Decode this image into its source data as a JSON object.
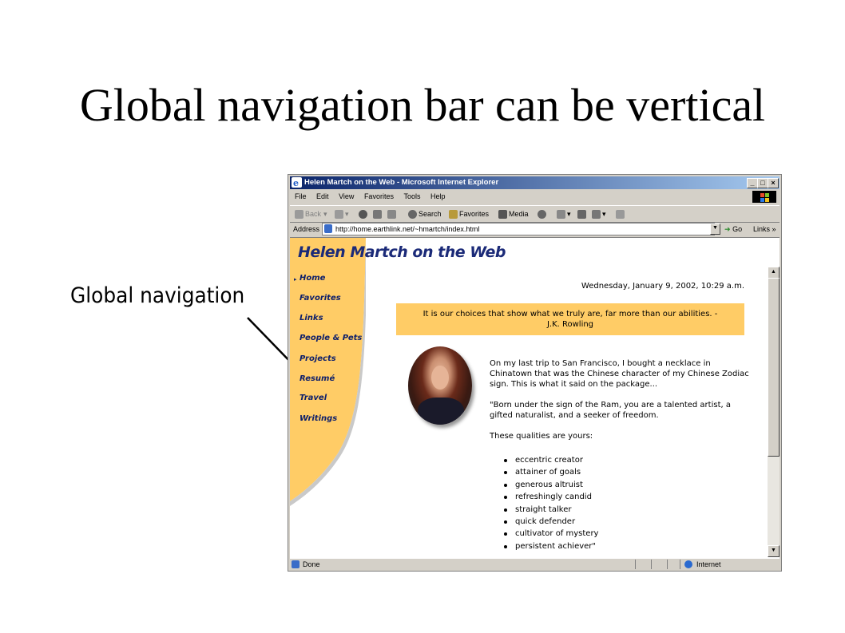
{
  "slide": {
    "title": "Global navigation bar can be vertical",
    "callout": "Global navigation"
  },
  "browser": {
    "window_title": "Helen Martch on the Web - Microsoft Internet Explorer",
    "window_buttons": [
      "_",
      "□",
      "×"
    ],
    "menu": [
      "File",
      "Edit",
      "View",
      "Favorites",
      "Tools",
      "Help"
    ],
    "toolbar": {
      "back": "Back",
      "search": "Search",
      "favorites": "Favorites",
      "media": "Media"
    },
    "address": {
      "label": "Address",
      "url": "http://home.earthlink.net/~hmartch/index.html",
      "go": "Go",
      "links": "Links"
    },
    "status": {
      "text": "Done",
      "zone": "Internet"
    }
  },
  "page": {
    "site_title_1": "Helen",
    "site_title_2": "Martch on the Web",
    "nav": [
      "Home",
      "Favorites",
      "Links",
      "People & Pets",
      "Projects",
      "Resumé",
      "Travel",
      "Writings"
    ],
    "date": "Wednesday, January 9, 2002, 10:29 a.m.",
    "quote_line1": "It is our choices that show what we truly are, far more than our abilities. -",
    "quote_line2": "J.K. Rowling",
    "paragraph1": "On my last trip to San Francisco, I bought a necklace in Chinatown that was the Chinese character of my Chinese Zodiac sign. This is what it said on the package...",
    "paragraph2": "\"Born under the sign of the Ram, you are a talented artist, a gifted naturalist, and a seeker of freedom.",
    "paragraph3": "These qualities are yours:",
    "qualities": [
      "eccentric creator",
      "attainer of goals",
      "generous altruist",
      "refreshingly candid",
      "straight talker",
      "quick defender",
      "cultivator of mystery",
      "persistent achiever\""
    ]
  },
  "colors": {
    "nav_background": "#ffcc66",
    "nav_text": "#0e1f6a",
    "titlebar_start": "#0a246a",
    "titlebar_end": "#a6caf0"
  }
}
